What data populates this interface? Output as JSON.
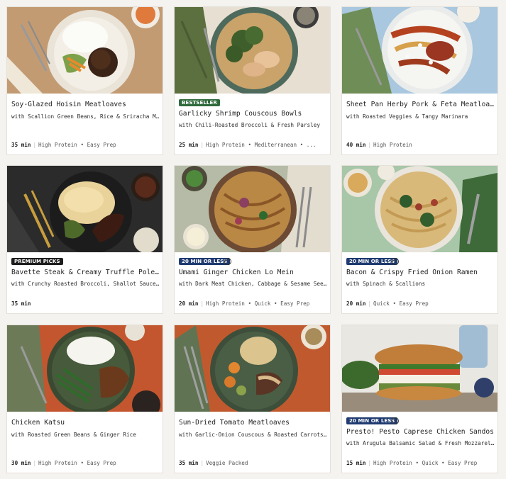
{
  "colors": {
    "bestseller": "#2f6a3c",
    "premium": "#1e1e1e",
    "quick": "#1f3b70",
    "card_bg": "#ffffff",
    "page_bg": "#f5f3ef"
  },
  "recipes": [
    {
      "title": "Soy-Glazed Hoisin Meatloaves",
      "subtitle": "with Scallion Green Beans, Rice & Sriracha Mayo",
      "time": "35 min",
      "tags": "High Protein • Easy Prep",
      "badge": ""
    },
    {
      "title": "Garlicky Shrimp Couscous Bowls",
      "subtitle": "with Chili-Roasted Broccoli & Fresh Parsley",
      "time": "25 min",
      "tags": "High Protein • Mediterranean • ...",
      "badge": "BESTSELLER"
    },
    {
      "title": "Sheet Pan Herby Pork & Feta Meatloaves",
      "subtitle": "with Roasted Veggies & Tangy Marinara",
      "time": "40 min",
      "tags": "High Protein",
      "badge": ""
    },
    {
      "title": "Bavette Steak & Creamy Truffle Polenta",
      "subtitle": "with Crunchy Roasted Broccoli, Shallot Sauce & Par...",
      "time": "35 min",
      "tags": "",
      "badge": "PREMIUM PICKS"
    },
    {
      "title": "Umami Ginger Chicken Lo Mein",
      "subtitle": "with Dark Meat Chicken, Cabbage & Sesame Seeds",
      "time": "20 min",
      "tags": "High Protein • Quick • Easy Prep",
      "badge": "20 MIN OR LESS"
    },
    {
      "title": "Bacon & Crispy Fried Onion Ramen",
      "subtitle": "with Spinach & Scallions",
      "time": "20 min",
      "tags": "Quick • Easy Prep",
      "badge": "20 MIN OR LESS"
    },
    {
      "title": "Chicken Katsu",
      "subtitle": "with Roasted Green Beans & Ginger Rice",
      "time": "30 min",
      "tags": "High Protein • Easy Prep",
      "badge": ""
    },
    {
      "title": "Sun-Dried Tomato Meatloaves",
      "subtitle": "with Garlic-Onion Couscous & Roasted Carrots & Zu...",
      "time": "35 min",
      "tags": "Veggie Packed",
      "badge": ""
    },
    {
      "title": "Presto! Pesto Caprese Chicken Sandos",
      "subtitle": "with Arugula Balsamic Salad & Fresh Mozzarella",
      "time": "15 min",
      "tags": "High Protein • Quick • Easy Prep",
      "badge": "20 MIN OR LESS"
    }
  ]
}
